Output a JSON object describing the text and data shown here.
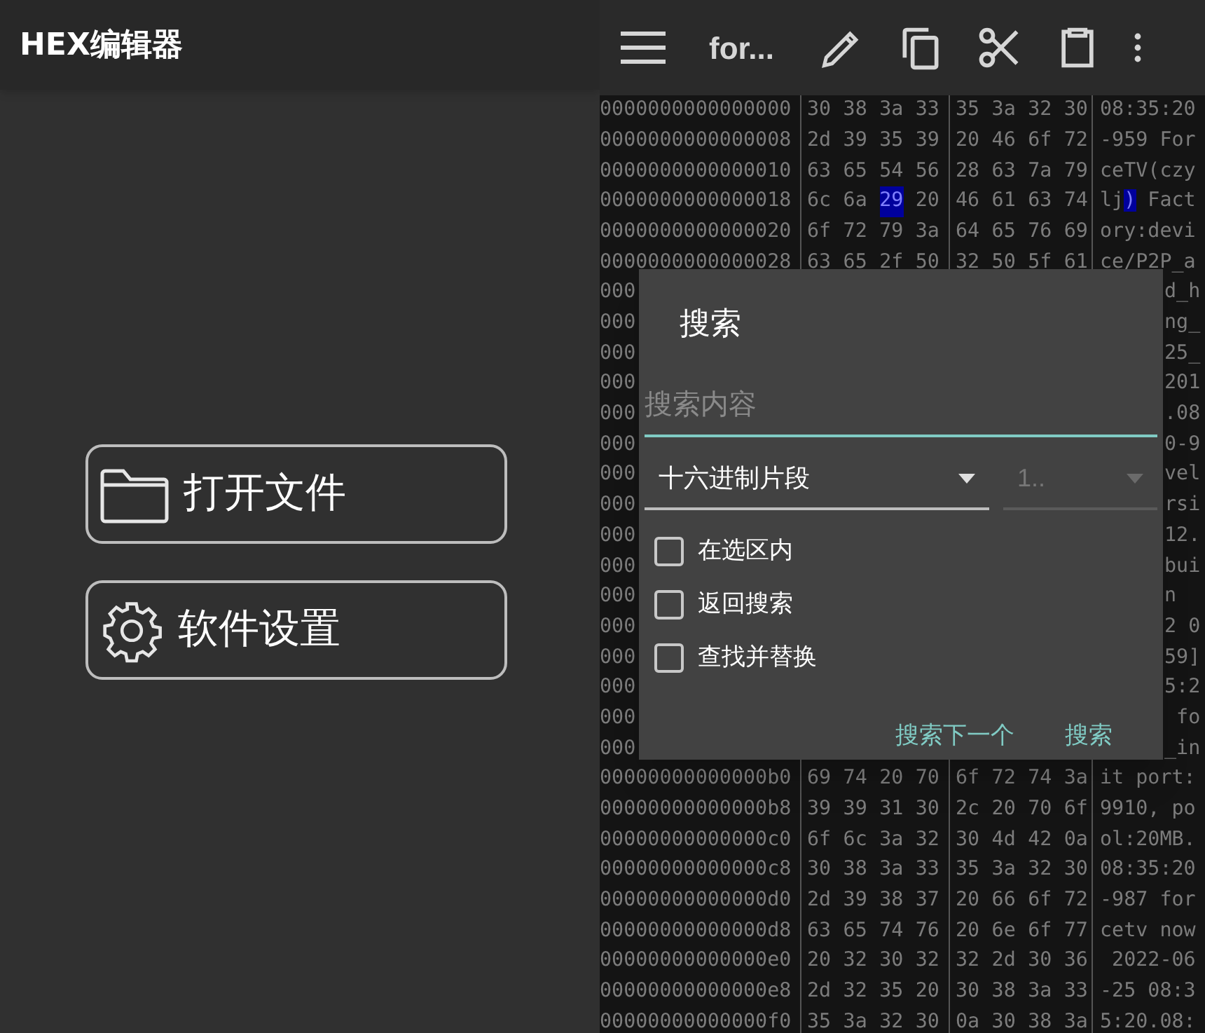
{
  "app_title": "HEX编辑器",
  "home_buttons": [
    {
      "kind": "folder",
      "label": "打开文件"
    },
    {
      "kind": "gear",
      "label": "软件设置"
    }
  ],
  "toolbar": {
    "file_name": "for..."
  },
  "hex_rows": [
    {
      "kind": "full",
      "address": "0000000000000000",
      "bytes": [
        "30",
        "38",
        "3a",
        "33",
        "35",
        "3a",
        "32",
        "30"
      ],
      "text": "08:35:20"
    },
    {
      "kind": "full",
      "address": "0000000000000008",
      "bytes": [
        "2d",
        "39",
        "35",
        "39",
        "20",
        "46",
        "6f",
        "72"
      ],
      "text": "-959 For"
    },
    {
      "kind": "full",
      "address": "0000000000000010",
      "bytes": [
        "63",
        "65",
        "54",
        "56",
        "28",
        "63",
        "7a",
        "79"
      ],
      "text": "ceTV(czy"
    },
    {
      "kind": "selection",
      "address": "0000000000000018",
      "bytes": [
        {
          "hex": "6c",
          "selected": false
        },
        {
          "hex": "6a",
          "selected": false
        },
        {
          "hex": "29",
          "selected": true
        },
        {
          "hex": "20",
          "selected": false
        },
        {
          "hex": "46",
          "selected": false
        },
        {
          "hex": "61",
          "selected": false
        },
        {
          "hex": "63",
          "selected": false
        },
        {
          "hex": "74",
          "selected": false
        }
      ],
      "text": [
        {
          "text": "lj",
          "selected": false
        },
        {
          "text": ")",
          "selected": true
        },
        {
          "text": " Fact",
          "selected": false
        }
      ]
    },
    {
      "kind": "full",
      "address": "0000000000000020",
      "bytes": [
        "6f",
        "72",
        "79",
        "3a",
        "64",
        "65",
        "76",
        "69"
      ],
      "text": "ory:devi"
    },
    {
      "kind": "full",
      "address": "0000000000000028",
      "bytes": [
        "63",
        "65",
        "2f",
        "50",
        "32",
        "50",
        "5f",
        "61"
      ],
      "text": "ce/P2P_a"
    },
    {
      "kind": "covered",
      "address": "000",
      "text": "d_h"
    },
    {
      "kind": "covered",
      "address": "000",
      "text": "ng_"
    },
    {
      "kind": "covered",
      "address": "000",
      "text": "25_"
    },
    {
      "kind": "covered",
      "address": "000",
      "text": "201"
    },
    {
      "kind": "covered",
      "address": "000",
      "text": ".08"
    },
    {
      "kind": "covered",
      "address": "000",
      "text": "0-9"
    },
    {
      "kind": "covered",
      "address": "000",
      "text": "vel"
    },
    {
      "kind": "covered",
      "address": "000",
      "text": "rsi"
    },
    {
      "kind": "covered",
      "address": "000",
      "text": "12."
    },
    {
      "kind": "covered",
      "address": "000",
      "text": "bui"
    },
    {
      "kind": "covered",
      "address": "000",
      "text": "n"
    },
    {
      "kind": "covered",
      "address": "000",
      "text": "2 0"
    },
    {
      "kind": "covered",
      "address": "000",
      "text": "59]"
    },
    {
      "kind": "covered",
      "address": "000",
      "text": "5:2"
    },
    {
      "kind": "covered",
      "address": "000",
      "text": " fo"
    },
    {
      "kind": "covered",
      "address": "000",
      "text": "_in"
    },
    {
      "kind": "full",
      "address": "00000000000000b0",
      "bytes": [
        "69",
        "74",
        "20",
        "70",
        "6f",
        "72",
        "74",
        "3a"
      ],
      "text": "it port:"
    },
    {
      "kind": "full",
      "address": "00000000000000b8",
      "bytes": [
        "39",
        "39",
        "31",
        "30",
        "2c",
        "20",
        "70",
        "6f"
      ],
      "text": "9910, po"
    },
    {
      "kind": "full",
      "address": "00000000000000c0",
      "bytes": [
        "6f",
        "6c",
        "3a",
        "32",
        "30",
        "4d",
        "42",
        "0a"
      ],
      "text": "ol:20MB."
    },
    {
      "kind": "full",
      "address": "00000000000000c8",
      "bytes": [
        "30",
        "38",
        "3a",
        "33",
        "35",
        "3a",
        "32",
        "30"
      ],
      "text": "08:35:20"
    },
    {
      "kind": "full",
      "address": "00000000000000d0",
      "bytes": [
        "2d",
        "39",
        "38",
        "37",
        "20",
        "66",
        "6f",
        "72"
      ],
      "text": "-987 for"
    },
    {
      "kind": "full",
      "address": "00000000000000d8",
      "bytes": [
        "63",
        "65",
        "74",
        "76",
        "20",
        "6e",
        "6f",
        "77"
      ],
      "text": "cetv now"
    },
    {
      "kind": "full",
      "address": "00000000000000e0",
      "bytes": [
        "20",
        "32",
        "30",
        "32",
        "32",
        "2d",
        "30",
        "36"
      ],
      "text": " 2022-06"
    },
    {
      "kind": "full",
      "address": "00000000000000e8",
      "bytes": [
        "2d",
        "32",
        "35",
        "20",
        "30",
        "38",
        "3a",
        "33"
      ],
      "text": "-25 08:3"
    },
    {
      "kind": "full",
      "address": "00000000000000f0",
      "bytes": [
        "35",
        "3a",
        "32",
        "30",
        "0a",
        "30",
        "38",
        "3a"
      ],
      "text": "5:20.08:"
    }
  ],
  "dialog": {
    "title": "搜索",
    "search_field": {
      "placeholder": "搜索内容"
    },
    "mode_dropdown": {
      "value": "十六进制片段",
      "disabled": false
    },
    "size_dropdown": {
      "value": "1..",
      "disabled": true
    },
    "options": [
      {
        "label": "在选区内",
        "checked": false
      },
      {
        "label": "返回搜索",
        "checked": false
      },
      {
        "label": "查找并替换",
        "checked": false
      }
    ],
    "buttons": [
      "搜索下一个",
      "搜索"
    ]
  }
}
